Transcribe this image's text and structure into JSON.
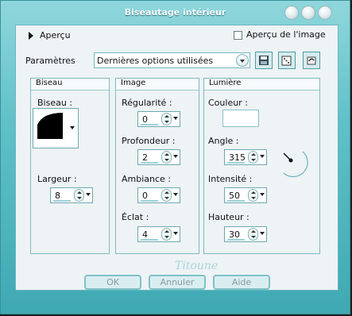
{
  "window": {
    "title": "Biseautage intérieur"
  },
  "preview": {
    "label": "Aperçu",
    "checkbox_label": "Aperçu de l'image"
  },
  "params": {
    "label": "Paramètres",
    "value": "Dernières options utilisées"
  },
  "bevel": {
    "title": "Biseau",
    "bevel_label": "Biseau :",
    "width_label": "Largeur :",
    "width_value": "8"
  },
  "image": {
    "title": "Image",
    "smoothness_label": "Régularité :",
    "smoothness_value": "0",
    "depth_label": "Profondeur :",
    "depth_value": "2",
    "ambience_label": "Ambiance :",
    "ambience_value": "0",
    "shine_label": "Éclat :",
    "shine_value": "4"
  },
  "light": {
    "title": "Lumière",
    "color_label": "Couleur :",
    "angle_label": "Angle :",
    "angle_value": "315",
    "intensity_label": "Intensité :",
    "intensity_value": "50",
    "elevation_label": "Hauteur :",
    "elevation_value": "30"
  },
  "buttons": {
    "ok": "OK",
    "cancel": "Annuler",
    "help": "Aide"
  },
  "watermark": "Titoune",
  "colors": {
    "accent": "#5fc0c8",
    "panel": "#eef3f5",
    "border": "#7fb9c1"
  }
}
